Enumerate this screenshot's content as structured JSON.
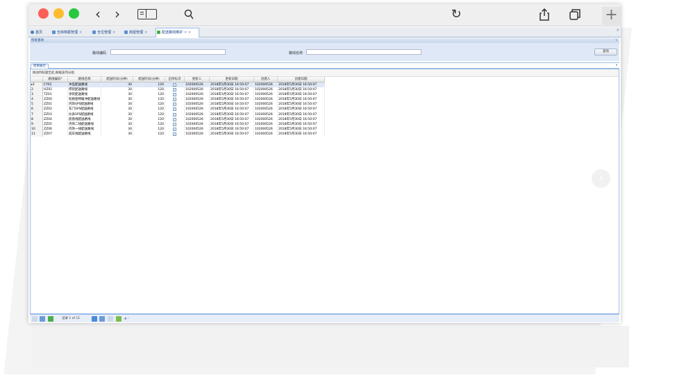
{
  "tabs": [
    {
      "label": "首页",
      "close": ""
    },
    {
      "label": "仓库档案管理",
      "close": "×"
    },
    {
      "label": "仓位管理",
      "close": "×"
    },
    {
      "label": "房屋管理",
      "close": "×"
    },
    {
      "label": "配送路线维护",
      "close": "× ×"
    }
  ],
  "window_close": "×",
  "query_panel": {
    "title": "检索查询",
    "collapse": "«",
    "route_code_label": "路线编码",
    "route_code_value": "",
    "route_name_label": "路线名称",
    "route_name_value": "",
    "search_button": "查询"
  },
  "results_panel": {
    "tab": "结果展示",
    "caret": "▾"
  },
  "grid": {
    "group_hint": "拖动列标题至此,根据该列分组",
    "columns": [
      "",
      "路线编码*",
      "路线名称",
      "配送时间(分钟)",
      "配送时间(分钟)",
      "启停标识",
      "更新人",
      "更新日期",
      "创建人",
      "创建日期"
    ],
    "rows": [
      [
        "▸1",
        "CY01",
        "冲压配送路线",
        "30",
        "120",
        "✓",
        "102000526",
        "2018年5月30日 16:50:07",
        "102000526",
        "2018年5月30日 16:50:07"
      ],
      [
        "2",
        "HZ01",
        "焊装配送路线",
        "30",
        "120",
        "✓",
        "102000526",
        "2018年5月30日 16:50:07",
        "102000526",
        "2018年5月30日 16:50:07"
      ],
      [
        "3",
        "TZ01",
        "涂装配送路线",
        "30",
        "120",
        "✓",
        "102000526",
        "2018年5月30日 16:50:07",
        "102000526",
        "2018年5月30日 16:50:07"
      ],
      [
        "4",
        "ZZ00",
        "轮胎座椅缓冲配送路线",
        "30",
        "120",
        "✓",
        "102000526",
        "2018年5月30日 16:50:07",
        "102000526",
        "2018年5月30日 16:50:07"
      ],
      [
        "5",
        "ZZ01",
        "内饰SPS配送路线",
        "30",
        "120",
        "✓",
        "102000526",
        "2018年5月30日 16:50:07",
        "102000526",
        "2018年5月30日 16:50:07"
      ],
      [
        "6",
        "ZZ02",
        "车门SPS配送路线",
        "30",
        "120",
        "✓",
        "102000526",
        "2018年5月30日 16:50:07",
        "102000526",
        "2018年5月30日 16:50:07"
      ],
      [
        "7",
        "ZZ03",
        "仪表SPS配送路线",
        "30",
        "120",
        "✓",
        "102000526",
        "2018年5月30日 16:50:07",
        "102000526",
        "2018年5月30日 16:50:07"
      ],
      [
        "8",
        "ZZ04",
        "底盘线配送路线",
        "30",
        "120",
        "✓",
        "102000526",
        "2018年5月30日 16:50:07",
        "102000526",
        "2018年5月30日 16:50:07"
      ],
      [
        "9",
        "ZZ05",
        "内饰二线配送路线",
        "30",
        "120",
        "✓",
        "102000526",
        "2018年5月30日 16:50:07",
        "102000526",
        "2018年5月30日 16:50:07"
      ],
      [
        "10",
        "ZZ06",
        "内饰一线配送路线",
        "30",
        "120",
        "✓",
        "102000526",
        "2018年5月30日 16:50:07",
        "102000526",
        "2018年5月30日 16:50:07"
      ],
      [
        "11",
        "ZZ07",
        "成车线配送路线",
        "30",
        "120",
        "✓",
        "102000526",
        "2018年5月30日 16:50:07",
        "102000526",
        "2018年5月30日 16:50:07"
      ]
    ]
  },
  "pager": {
    "record_text": "记录 1 of 11",
    "arrow": "▲ ‹"
  },
  "icons": {
    "back": "‹",
    "forward": "›",
    "reload": "↻",
    "new_tab": "+",
    "next_page": "›"
  },
  "colors": {
    "close": "#fc5f57",
    "minimize": "#fdbc2e",
    "maximize": "#28c840",
    "grid_header": "#dfe8f6",
    "selected_row": "#dfe8f6"
  }
}
